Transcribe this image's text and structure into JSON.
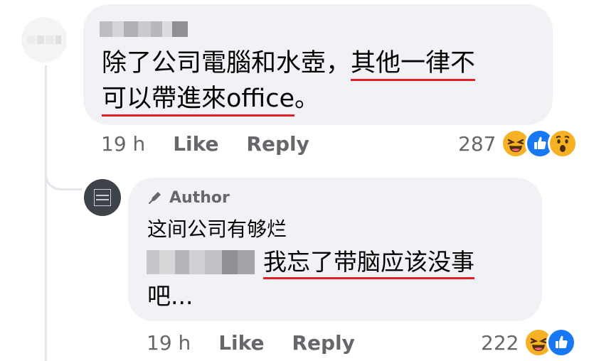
{
  "comment": {
    "text_part1": "除了公司電腦和水壺，",
    "text_part2": "其他一律不",
    "text_line2_underlined": "可以帶進來office",
    "text_line2_end": "。",
    "time": "19 h",
    "like_label": "Like",
    "reply_label": "Reply",
    "reaction_count": "287",
    "reactions": [
      "haha-icon",
      "like-icon",
      "wow-icon"
    ]
  },
  "reply": {
    "badge_label": "Author",
    "line1": "这间公司有够烂",
    "line2_underlined": "我忘了带脑应该没事",
    "line3": "吧...",
    "time": "19 h",
    "like_label": "Like",
    "reply_label": "Reply",
    "reaction_count": "222",
    "reactions": [
      "haha-icon",
      "like-icon"
    ]
  },
  "colors": {
    "bubble_bg": "#f0f2f5",
    "meta_text": "#65676b",
    "underline": "#e41e26",
    "like_blue": "#1877f2",
    "haha_yellow": "#f7b125"
  }
}
